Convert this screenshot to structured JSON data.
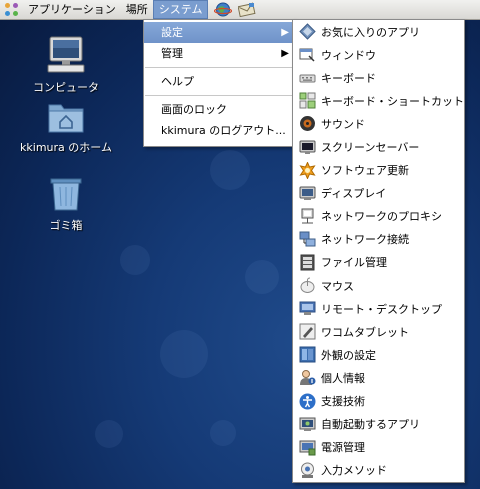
{
  "top_panel": {
    "menus": [
      "アプリケーション",
      "場所",
      "システム"
    ]
  },
  "desktop": {
    "icons": [
      {
        "label": "コンピュータ"
      },
      {
        "label": "kkimura のホーム"
      },
      {
        "label": "ゴミ箱"
      }
    ]
  },
  "system_menu": {
    "items": [
      "設定",
      "管理",
      "ヘルプ",
      "画面のロック",
      "kkimura のログアウト..."
    ]
  },
  "preferences_menu": {
    "items": [
      {
        "label": "お気に入りのアプリ",
        "icon": "favorites-icon"
      },
      {
        "label": "ウィンドウ",
        "icon": "windows-icon"
      },
      {
        "label": "キーボード",
        "icon": "keyboard-icon"
      },
      {
        "label": "キーボード・ショートカット",
        "icon": "keyboard-shortcuts-icon"
      },
      {
        "label": "サウンド",
        "icon": "sound-icon"
      },
      {
        "label": "スクリーンセーバー",
        "icon": "screensaver-icon"
      },
      {
        "label": "ソフトウェア更新",
        "icon": "software-update-icon"
      },
      {
        "label": "ディスプレイ",
        "icon": "display-icon"
      },
      {
        "label": "ネットワークのプロキシ",
        "icon": "network-proxy-icon"
      },
      {
        "label": "ネットワーク接続",
        "icon": "network-connections-icon"
      },
      {
        "label": "ファイル管理",
        "icon": "file-management-icon"
      },
      {
        "label": "マウス",
        "icon": "mouse-icon"
      },
      {
        "label": "リモート・デスクトップ",
        "icon": "remote-desktop-icon"
      },
      {
        "label": "ワコムタブレット",
        "icon": "wacom-tablet-icon"
      },
      {
        "label": "外観の設定",
        "icon": "appearance-icon"
      },
      {
        "label": "個人情報",
        "icon": "personal-info-icon"
      },
      {
        "label": "支援技術",
        "icon": "accessibility-icon"
      },
      {
        "label": "自動起動するアプリ",
        "icon": "startup-apps-icon"
      },
      {
        "label": "電源管理",
        "icon": "power-management-icon"
      },
      {
        "label": "入力メソッド",
        "icon": "input-method-icon"
      }
    ]
  },
  "colors": {
    "highlight": "#7a9dcf",
    "desktop_bg": "#153a76"
  }
}
